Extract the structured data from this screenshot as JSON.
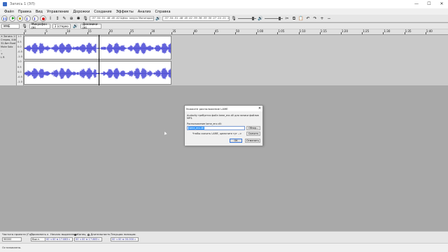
{
  "window": {
    "title": "Запись 1 (ЭЛ)",
    "minimize": "—",
    "maximize": "☐",
    "close": "✕"
  },
  "menu": [
    "Файл",
    "Правка",
    "Вид",
    "Управление",
    "Дорожки",
    "Создание",
    "Эффекты",
    "Анализ",
    "Справка"
  ],
  "toolbar": {
    "meter_record": "-57 -54 -51 -48 -45 -42  Щёлк: запуск Мониторинга 3  -15 -12 -9 -6 -3 0",
    "meter_play": "-57 -54 -51 -48 -45 -42 -39 -36 -33 -30 -27 -24 -21 -18 -15 -12 -9 -6 -3 0"
  },
  "devices": {
    "host": "MME",
    "input": "Микрофон (Hi",
    "channels": "2 (стерео",
    "output": "Динамики (Hi"
  },
  "ruler_ticks": [
    "0",
    "5",
    "10",
    "15",
    "20",
    "25",
    "30",
    "35",
    "40",
    "45",
    "50",
    "1:00",
    "1:05",
    "1:10",
    "1:15",
    "1:20",
    "1:25",
    "1:30",
    "1:35",
    "1:40"
  ],
  "track": {
    "info_rows": [
      "✕ Запись 1 ▾",
      "Стерео, 44kHz",
      "32-бит float",
      "Mute  Solo",
      "-",
      "+",
      "L      R"
    ],
    "scale": [
      "1.0",
      "0.5",
      "0.0",
      "-0.5",
      "-1.0"
    ]
  },
  "dialog": {
    "title": "Укажите расположение LAME",
    "close": "✕",
    "message": "Audacity требуется файл lame_enc.dll для записи файлов MP3.",
    "location_label": "Расположение lame_enc.dll:",
    "location_value": "lame_enc.dll",
    "browse_label": "Обзор...",
    "download_text": "Чтобы скачать LAME, щелкните тут -->",
    "download_label": "Скачать",
    "ok_label": "ОК",
    "cancel_label": "Отменить"
  },
  "selection": {
    "rate_label": "Частота проекта (Гц):",
    "rate_value": "96000",
    "snap_label": "Прилипать к",
    "snap_value": "Выкл.",
    "start_label": "Начало выделения:",
    "end_label": "Конец",
    "length_label": "Длительность",
    "position_label": "Текущая позиция:",
    "start_time": "00 ч 00 м 17.883 с",
    "end_time": "00 ч 00 м 17.883 с",
    "position_time": "00 ч 00 м 00.000 с"
  },
  "status": "Остановлено."
}
